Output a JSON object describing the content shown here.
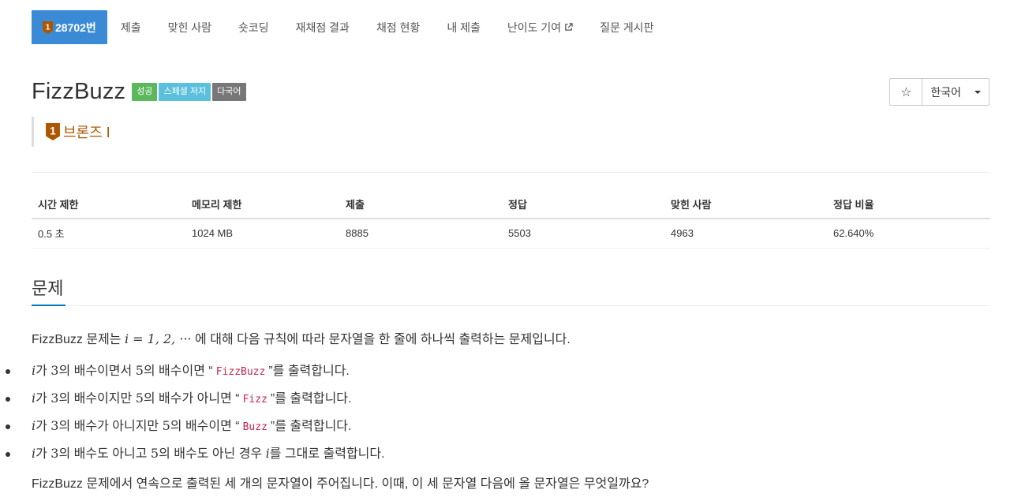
{
  "nav": {
    "problem_number": "28702번",
    "items": [
      "제출",
      "맞힌 사람",
      "숏코딩",
      "재채점 결과",
      "채점 현황",
      "내 제출",
      "난이도 기여",
      "질문 게시판"
    ]
  },
  "problem": {
    "title": "FizzBuzz",
    "labels": [
      "성공",
      "스페셜 저지",
      "다국어"
    ],
    "tier": "브론즈 I",
    "tier_number": "1",
    "language": "한국어",
    "star": "☆"
  },
  "stats": {
    "headers": [
      "시간 제한",
      "메모리 제한",
      "제출",
      "정답",
      "맞힌 사람",
      "정답 비율"
    ],
    "values": [
      "0.5 초",
      "1024 MB",
      "8885",
      "5503",
      "4963",
      "62.640%"
    ]
  },
  "section": {
    "title": "문제"
  },
  "statement": {
    "intro_before": "FizzBuzz 문제는 ",
    "intro_math": "i = 1, 2, ···",
    "intro_after": " 에 대해 다음 규칙에 따라 문자열을 한 줄에 하나씩 출력하는 문제입니다.",
    "rules": [
      {
        "var": "i",
        "text1": "가 ",
        "n1": "3",
        "text2": "의 배수이면서 ",
        "n2": "5",
        "text3": "의 배수이면 “",
        "code": "FizzBuzz",
        "text4": "”를 출력합니다."
      },
      {
        "var": "i",
        "text1": "가 ",
        "n1": "3",
        "text2": "의 배수이지만 ",
        "n2": "5",
        "text3": "의 배수가 아니면 “",
        "code": "Fizz",
        "text4": "”를 출력합니다."
      },
      {
        "var": "i",
        "text1": "가 ",
        "n1": "3",
        "text2": "의 배수가 아니지만 ",
        "n2": "5",
        "text3": "의 배수이면 “",
        "code": "Buzz",
        "text4": "”를 출력합니다."
      },
      {
        "var": "i",
        "text1": "가 ",
        "n1": "3",
        "text2": "의 배수도 아니고 ",
        "n2": "5",
        "text3": "의 배수도 아닌 경우 ",
        "code": "i",
        "text4": "를 그대로 출력합니다."
      }
    ],
    "last": "FizzBuzz 문제에서 연속으로 출력된 세 개의 문자열이 주어집니다. 이때, 이 세 문자열 다음에 올 문자열은 무엇일까요?"
  },
  "colors": {
    "nav_active": "#3a8ad6",
    "tier_bronze": "#ad5600",
    "label_success": "#5cb85c",
    "label_info": "#5bc0de",
    "label_dark": "#777777",
    "section_underline": "#0076c0"
  },
  "icons": {
    "tier": "bronze-tier-icon",
    "external": "external-link-icon",
    "star": "star-outline-icon",
    "caret": "caret-down-icon"
  }
}
